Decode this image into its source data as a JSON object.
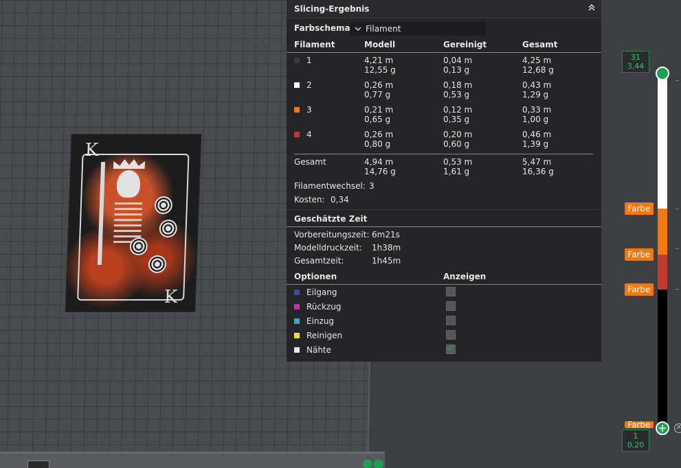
{
  "panel": {
    "title": "Slicing-Ergebnis",
    "collapse_icon": "chevron-up-double-icon",
    "farbschema_label": "Farbschema",
    "farbschema_value": "Filament",
    "columns": [
      "Filament",
      "Modell",
      "Gereinigt",
      "Gesamt"
    ],
    "filaments": [
      {
        "id": "1",
        "color": "#3a3a3a",
        "modell_m": "4,21 m",
        "modell_g": "12,55 g",
        "gereinigt_m": "0,04 m",
        "gereinigt_g": "0,13 g",
        "gesamt_m": "4,25 m",
        "gesamt_g": "12,68 g"
      },
      {
        "id": "2",
        "color": "#ffffff",
        "modell_m": "0,26 m",
        "modell_g": "0,77 g",
        "gereinigt_m": "0,18 m",
        "gereinigt_g": "0,53 g",
        "gesamt_m": "0,43 m",
        "gesamt_g": "1,29 g"
      },
      {
        "id": "3",
        "color": "#f5780e",
        "modell_m": "0,21 m",
        "modell_g": "0,65 g",
        "gereinigt_m": "0,12 m",
        "gereinigt_g": "0,35 g",
        "gesamt_m": "0,33 m",
        "gesamt_g": "1,00 g"
      },
      {
        "id": "4",
        "color": "#c0392b",
        "modell_m": "0,26 m",
        "modell_g": "0,80 g",
        "gereinigt_m": "0,20 m",
        "gereinigt_g": "0,60 g",
        "gesamt_m": "0,46 m",
        "gesamt_g": "1,39 g"
      }
    ],
    "total": {
      "label": "Gesamt",
      "modell_m": "4,94 m",
      "modell_g": "14,76 g",
      "gereinigt_m": "0,53 m",
      "gereinigt_g": "1,61 g",
      "gesamt_m": "5,47 m",
      "gesamt_g": "16,36 g"
    },
    "filamentwechsel_label": "Filamentwechsel:",
    "filamentwechsel_value": "3",
    "kosten_label": "Kosten:",
    "kosten_value": "0,34",
    "zeit_title": "Geschätzte Zeit",
    "zeit": [
      {
        "label": "Vorbereitungszeit:",
        "value": "6m21s"
      },
      {
        "label": "Modelldruckzeit:",
        "value": "1h38m"
      },
      {
        "label": "Gesamtzeit:",
        "value": "1h45m"
      }
    ],
    "optionen_label": "Optionen",
    "anzeigen_label": "Anzeigen",
    "optionen": [
      {
        "label": "Eilgang",
        "color": "#3b4aa8",
        "checked": false
      },
      {
        "label": "Rückzug",
        "color": "#c02bc0",
        "checked": false
      },
      {
        "label": "Einzug",
        "color": "#3ea6c8",
        "checked": false
      },
      {
        "label": "Reinigen",
        "color": "#f0e02a",
        "checked": false
      },
      {
        "label": "Nähte",
        "color": "#e8e8e8",
        "checked": true
      }
    ]
  },
  "layer_slider": {
    "top_layer": "31",
    "top_height": "3,44",
    "bottom_layer": "1",
    "bottom_height": "0,20",
    "farbe_label": "Farbe",
    "segment_colors": [
      "#ffffff",
      "#f5780e",
      "#c0392b",
      "#000000"
    ]
  },
  "model": {
    "corner_letter": "K"
  }
}
